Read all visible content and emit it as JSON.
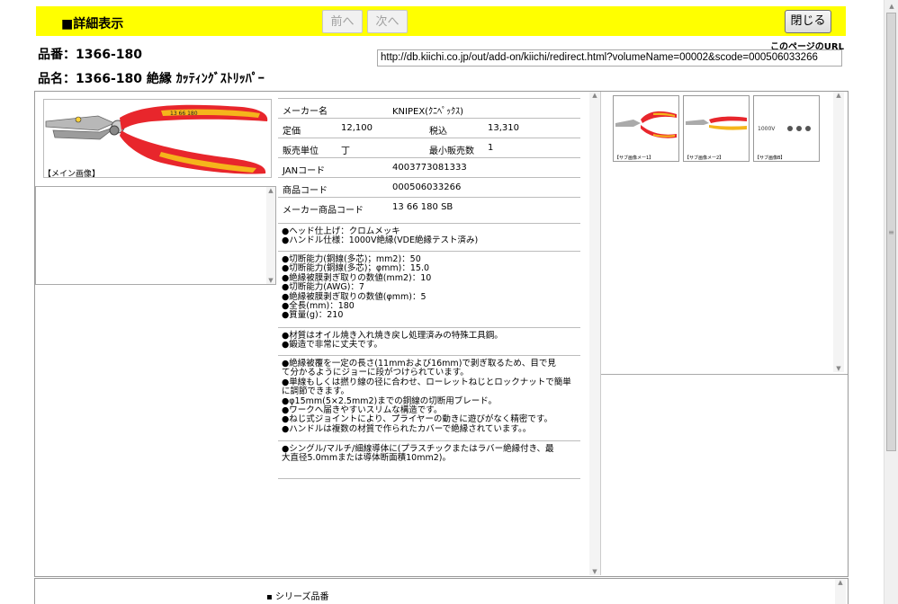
{
  "header": {
    "title": "■詳細表示",
    "prev_label": "前へ",
    "next_label": "次へ",
    "close_label": "閉じる"
  },
  "product": {
    "code_line": "品番：1366-180",
    "name_line": "品名：1366-180 絶縁 ｶｯﾃｨﾝｸﾞｽﾄﾘｯﾊﾟｰ"
  },
  "url": {
    "label": "このページのURL",
    "value": "http://db.kiichi.co.jp/out/add-on/kiichi/redirect.html?volumeName=00002&scode=000506033266"
  },
  "main_image": {
    "caption": "【メイン画像】",
    "plier_text": "13 66 180"
  },
  "specs": {
    "maker_label": "メーカー名",
    "maker_value": "KNIPEX(ｸﾆﾍﾟｯｸｽ)",
    "price_label": "定価",
    "price_value": "12,100",
    "tax_label": "税込",
    "tax_value": "13,310",
    "unit_label": "販売単位",
    "unit_value": "丁",
    "min_label": "最小販売数",
    "min_value": "1",
    "jan_label": "JANコード",
    "jan_value": "4003773081333",
    "item_code_label": "商品コード",
    "item_code_value": "000506033266",
    "maker_code_label": "メーカー商品コード",
    "maker_code_value": "13 66 180 SB"
  },
  "descriptions": [
    [
      "●ヘッド仕上げ：クロムメッキ",
      "●ハンドル仕様：1000V絶縁(VDE絶縁テスト済み)"
    ],
    [
      "●切断能力(銅線(多芯)；mm2)：50",
      "●切断能力(銅線(多芯)；φmm)：15.0",
      "●絶縁被膜剥ぎ取りの数値(mm2)：10",
      "●切断能力(AWG)：7",
      "●絶縁被膜剥ぎ取りの数値(φmm)：5",
      "●全長(mm)：180",
      "●質量(g)：210"
    ],
    [
      "●材質はオイル焼き入れ焼き戻し処理済みの特殊工具鋼。",
      "●鍛造で非常に丈夫です。"
    ],
    [
      "●絶縁被覆を一定の長さ(11mmおよび16mm)で剥ぎ取るため、目で見",
      "て分かるようにジョーに段がつけられています。",
      "●単線もしくは撚り線の径に合わせ、ローレットねじとロックナットで簡単",
      "に調節できます。",
      "●φ15mm(5×2.5mm2)までの銅線の切断用ブレード。",
      "●ワークへ届きやすいスリムな構造です。",
      "●ねじ式ジョイントにより、プライヤーの動きに遊びがなく精密です。",
      "●ハンドルは複数の材質で作られたカバーで絶縁されています。。"
    ],
    [
      "●シングル/マルチ/細線導体に(プラスチックまたはラバー絶縁付き、最",
      "大直径5.0mmまたは導体断面積10mm2)。"
    ]
  ],
  "thumbnails": [
    {
      "caption": "【サブ画像メー1】"
    },
    {
      "caption": "【サブ画像メー2】"
    },
    {
      "caption": "【サブ画像B】",
      "text": "1000V"
    }
  ],
  "series": {
    "label": "シリーズ品番"
  },
  "colors": {
    "header_bg": "#ffff00",
    "plier_red": "#e8262c",
    "plier_yellow": "#f5b51b"
  }
}
